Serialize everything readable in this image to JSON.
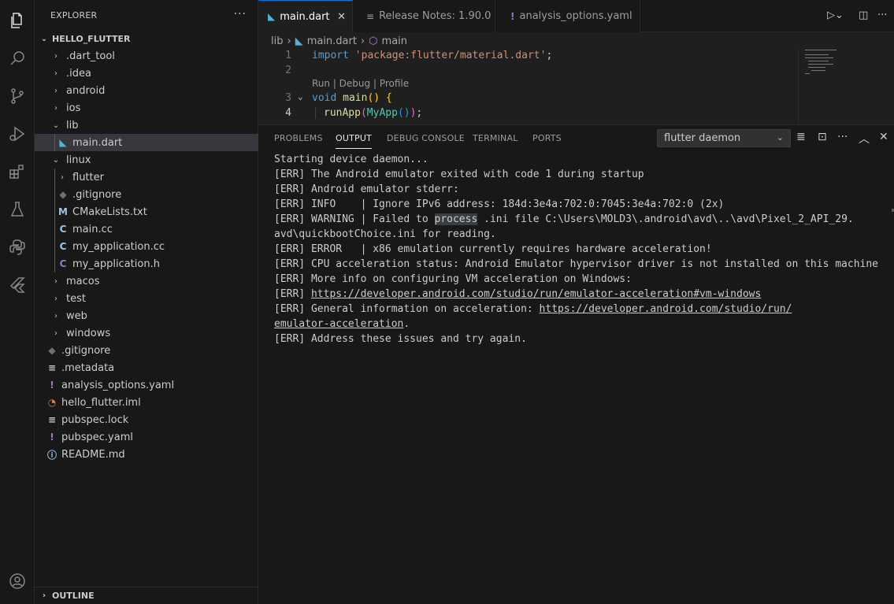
{
  "sidebar": {
    "title": "EXPLORER",
    "more": "···",
    "project": "HELLO_FLUTTER",
    "outline": "OUTLINE",
    "tree": [
      {
        "label": ".dart_tool",
        "depth": 1,
        "kind": "folder",
        "open": false
      },
      {
        "label": ".idea",
        "depth": 1,
        "kind": "folder",
        "open": false
      },
      {
        "label": "android",
        "depth": 1,
        "kind": "folder",
        "open": false
      },
      {
        "label": "ios",
        "depth": 1,
        "kind": "folder",
        "open": false
      },
      {
        "label": "lib",
        "depth": 1,
        "kind": "folder",
        "open": true
      },
      {
        "label": "main.dart",
        "depth": 2,
        "kind": "dart",
        "selected": true
      },
      {
        "label": "linux",
        "depth": 1,
        "kind": "folder",
        "open": true
      },
      {
        "label": "flutter",
        "depth": 2,
        "kind": "folder",
        "open": false
      },
      {
        "label": ".gitignore",
        "depth": 2,
        "kind": "gitignore"
      },
      {
        "label": "CMakeLists.txt",
        "depth": 2,
        "kind": "cmake"
      },
      {
        "label": "main.cc",
        "depth": 2,
        "kind": "cpp"
      },
      {
        "label": "my_application.cc",
        "depth": 2,
        "kind": "cpp"
      },
      {
        "label": "my_application.h",
        "depth": 2,
        "kind": "header"
      },
      {
        "label": "macos",
        "depth": 1,
        "kind": "folder",
        "open": false
      },
      {
        "label": "test",
        "depth": 1,
        "kind": "folder",
        "open": false
      },
      {
        "label": "web",
        "depth": 1,
        "kind": "folder",
        "open": false
      },
      {
        "label": "windows",
        "depth": 1,
        "kind": "folder",
        "open": false
      },
      {
        "label": ".gitignore",
        "depth": 1,
        "kind": "gitignore"
      },
      {
        "label": ".metadata",
        "depth": 1,
        "kind": "lines"
      },
      {
        "label": "analysis_options.yaml",
        "depth": 1,
        "kind": "yaml"
      },
      {
        "label": "hello_flutter.iml",
        "depth": 1,
        "kind": "rss"
      },
      {
        "label": "pubspec.lock",
        "depth": 1,
        "kind": "lines"
      },
      {
        "label": "pubspec.yaml",
        "depth": 1,
        "kind": "yaml"
      },
      {
        "label": "README.md",
        "depth": 1,
        "kind": "info"
      }
    ]
  },
  "icons": {
    "folder_closed": "›",
    "folder_open": "⌄",
    "dart": "◣",
    "gitignore": "◆",
    "cmake": "M",
    "cpp": "C",
    "header": "C",
    "yaml": "!",
    "rss": "◔",
    "lines": "≡",
    "info": "ⓘ"
  },
  "colors": {
    "dart": "#4fb3d9",
    "gitignore": "#6f6f6f",
    "cmake": "#a3c2e0",
    "cpp": "#9fc5e8",
    "header": "#a074c4",
    "yaml": "#a074c4",
    "rss": "#e37933",
    "lines": "#cccccc",
    "info": "#9fc5e8",
    "accent": "#0078d4"
  },
  "tabs": [
    {
      "label": "main.dart",
      "icon": "◣",
      "active": true,
      "close": "✕"
    },
    {
      "label": "Release Notes: 1.90.0",
      "icon": "≡",
      "active": false
    },
    {
      "label": "analysis_options.yaml",
      "icon": "!",
      "active": false
    }
  ],
  "breadcrumb": {
    "folder": "lib",
    "file": "main.dart",
    "symbol": "main",
    "sep": "›"
  },
  "editor": {
    "lens": "Run | Debug | Profile",
    "lines": [
      {
        "num": "1",
        "text": "import 'package:flutter/material.dart';"
      },
      {
        "num": "2",
        "text": ""
      },
      {
        "num": "3",
        "text": "void main() {"
      },
      {
        "num": "4",
        "text": "  runApp(MyApp());"
      }
    ]
  },
  "panel": {
    "tabs": [
      "PROBLEMS",
      "OUTPUT",
      "DEBUG CONSOLE",
      "TERMINAL",
      "PORTS"
    ],
    "active_tab": "OUTPUT",
    "channel": "flutter daemon",
    "output": [
      "Starting device daemon...",
      "[ERR] The Android emulator exited with code 1 during startup",
      "[ERR] Android emulator stderr:",
      "[ERR] INFO    | Ignore IPv6 address: 184d:3e4a:702:0:7045:3e4a:702:0 (2x)",
      "[ERR] WARNING | Failed to process .ini file C:\\Users\\MOLD3\\.android\\avd\\..\\avd\\Pixel_2_API_29.",
      "avd\\quickbootChoice.ini for reading.",
      "[ERR] ERROR   | x86 emulation currently requires hardware acceleration!",
      "[ERR] CPU acceleration status: Android Emulator hypervisor driver is not installed on this machine",
      "[ERR] More info on configuring VM acceleration on Windows:",
      "[ERR] https://developer.android.com/studio/run/emulator-acceleration#vm-windows",
      "[ERR] General information on acceleration: https://developer.android.com/studio/run/",
      "emulator-acceleration.",
      "[ERR] Address these issues and try again."
    ]
  }
}
